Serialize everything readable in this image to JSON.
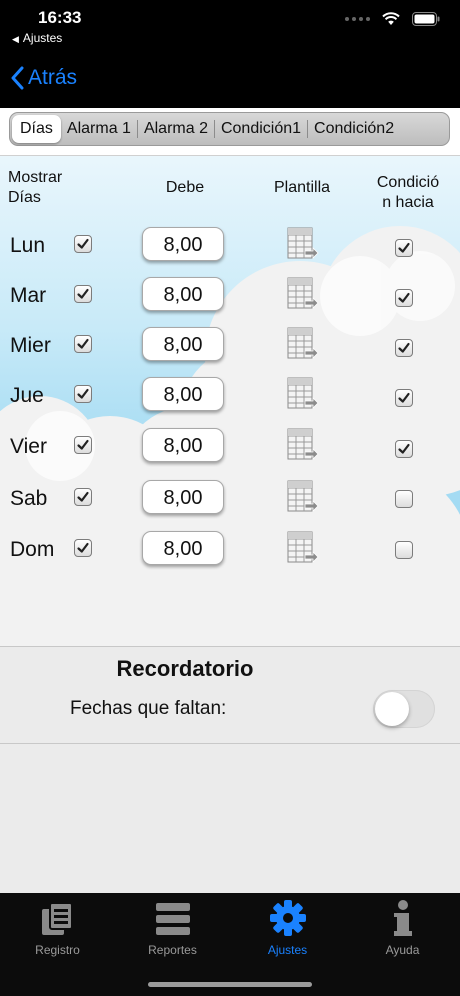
{
  "status_bar": {
    "time": "16:33",
    "back_app": "Ajustes"
  },
  "nav": {
    "back_label": "Atrás"
  },
  "tabs": [
    {
      "label": "Días",
      "active": true
    },
    {
      "label": "Alarma 1",
      "active": false
    },
    {
      "label": "Alarma 2",
      "active": false
    },
    {
      "label": "Condición1",
      "active": false
    },
    {
      "label": "Condición2",
      "active": false
    }
  ],
  "headers": {
    "show_days": [
      "Mostrar",
      "Días"
    ],
    "due": "Debe",
    "template": "Plantilla",
    "condition": [
      "Condició",
      "n hacia"
    ]
  },
  "days": [
    {
      "name": "Lun",
      "show": true,
      "due": "8,00",
      "condition": true
    },
    {
      "name": "Mar",
      "show": true,
      "due": "8,00",
      "condition": true
    },
    {
      "name": "Mier",
      "show": true,
      "due": "8,00",
      "condition": true
    },
    {
      "name": "Jue",
      "show": true,
      "due": "8,00",
      "condition": true
    },
    {
      "name": "Vier",
      "show": true,
      "due": "8,00",
      "condition": true
    },
    {
      "name": "Sab",
      "show": true,
      "due": "8,00",
      "condition": false
    },
    {
      "name": "Dom",
      "show": true,
      "due": "8,00",
      "condition": false
    }
  ],
  "reminder": {
    "title": "Recordatorio",
    "missing_dates_label": "Fechas que faltan:",
    "missing_dates_on": false
  },
  "tab_bar": [
    {
      "label": "Registro",
      "icon": "documents-icon",
      "active": false
    },
    {
      "label": "Reportes",
      "icon": "list-icon",
      "active": false
    },
    {
      "label": "Ajustes",
      "icon": "gear-icon",
      "active": true
    },
    {
      "label": "Ayuda",
      "icon": "info-icon",
      "active": false
    }
  ],
  "colors": {
    "accent": "#1a82ff",
    "nav_bg": "#000000",
    "sky": "#9cd8f3"
  }
}
